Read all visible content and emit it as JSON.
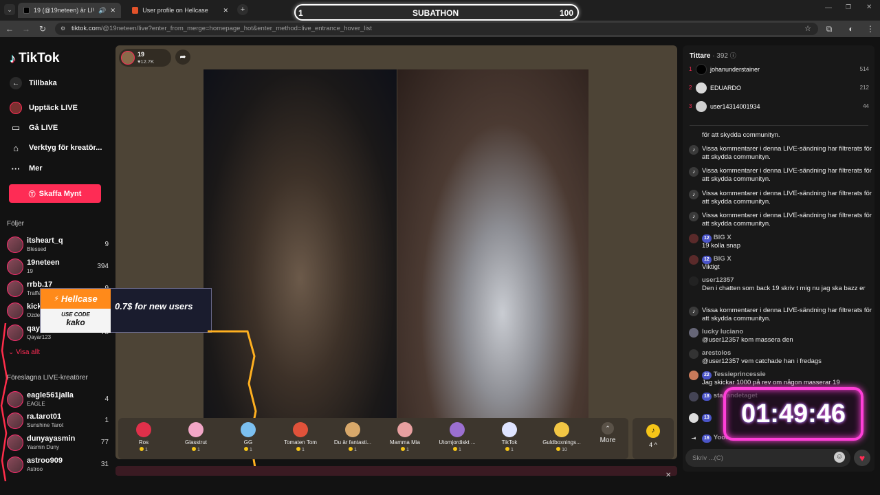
{
  "browser": {
    "tabs": [
      {
        "label": "19 (@19neteen) är LIVE – T"
      },
      {
        "label": "User profile on Hellcase"
      }
    ],
    "url_host": "tiktok.com",
    "url_path": "/@19neteen/live?enter_from_merge=homepage_hot&enter_method=live_entrance_hover_list"
  },
  "overlay": {
    "subathon_left": "1",
    "subathon_title": "SUBATHON",
    "subathon_right": "100",
    "timer": "01:49:46",
    "hellcase_brand": "Hellcase",
    "hellcase_use_code": "USE CODE",
    "hellcase_code": "kako",
    "hellcase_offer": "0.7$ for new users"
  },
  "sidebar": {
    "logo": "TikTok",
    "back": "Tillbaka",
    "nav": [
      {
        "label": "Upptäck LIVE"
      },
      {
        "label": "Gå LIVE"
      },
      {
        "label": "Verktyg för kreatör..."
      },
      {
        "label": "Mer"
      }
    ],
    "coins_button": "Skaffa Mynt",
    "following_title": "Följer",
    "following": [
      {
        "name": "itsheart_q",
        "sub": "Blessed",
        "count": "9"
      },
      {
        "name": "19neteen",
        "sub": "19",
        "count": "394"
      },
      {
        "name": "rrbb.17",
        "sub": "Traffe",
        "count": "9"
      },
      {
        "name": "kick",
        "sub": "Ozde",
        "count": ""
      },
      {
        "name": "qaya",
        "sub": "Qayar123",
        "count": "78"
      }
    ],
    "show_all": "Visa allt",
    "suggested_title": "Föreslagna LIVE-kreatörer",
    "suggested": [
      {
        "name": "eagle561jalla",
        "sub": "EAGLE",
        "count": "4"
      },
      {
        "name": "ra.tarot01",
        "sub": "Sunshine Tarot",
        "count": "1"
      },
      {
        "name": "dunyayasmin",
        "sub": "Yasmin Duny",
        "count": "77"
      },
      {
        "name": "astroo909",
        "sub": "Astroo",
        "count": "31"
      }
    ]
  },
  "host": {
    "name": "19",
    "likes": "12.7K"
  },
  "gifts": [
    {
      "name": "Ros",
      "price": "1",
      "color": "#e0304a"
    },
    {
      "name": "Glasstrut",
      "price": "1",
      "color": "#f2a6c6"
    },
    {
      "name": "GG",
      "price": "1",
      "color": "#7cc0f0"
    },
    {
      "name": "Tomaten Tom",
      "price": "1",
      "color": "#e0523a"
    },
    {
      "name": "Du är fantasti...",
      "price": "1",
      "color": "#d8a86a"
    },
    {
      "name": "Mamma Mia",
      "price": "1",
      "color": "#e8a0a0"
    },
    {
      "name": "Utomjordiskt ...",
      "price": "1",
      "color": "#9b6fd0"
    },
    {
      "name": "TikTok",
      "price": "1",
      "color": "#dfe4ff"
    },
    {
      "name": "Guldboxnings...",
      "price": "10",
      "color": "#f2c644"
    }
  ],
  "gift_more": "More",
  "gift_coins_count": "4",
  "chat": {
    "viewers_label": "Tittare",
    "viewers_count": "· 392",
    "top_viewers": [
      {
        "rank": "1",
        "name": "johanunderstainer",
        "score": "514"
      },
      {
        "rank": "2",
        "name": "EDUARDO",
        "score": "212"
      },
      {
        "rank": "3",
        "name": "user14314001934",
        "score": "44"
      }
    ],
    "messages": [
      {
        "user": "",
        "text": "för att skydda communityn."
      },
      {
        "user": "",
        "text": "Vissa kommentarer i denna LIVE-sändning har filtrerats för att skydda communityn."
      },
      {
        "user": "",
        "text": "Vissa kommentarer i denna LIVE-sändning har filtrerats för att skydda communityn."
      },
      {
        "user": "",
        "text": "Vissa kommentarer i denna LIVE-sändning har filtrerats för att skydda communityn."
      },
      {
        "user": "",
        "text": "Vissa kommentarer i denna LIVE-sändning har filtrerats för att skydda communityn."
      },
      {
        "level": "12",
        "user": "BIG X",
        "text": "19 kolla snap"
      },
      {
        "level": "12",
        "user": "BIG X",
        "text": "Viktigt"
      },
      {
        "user": "user12357",
        "text": "Den i chatten som back 19 skriv t mig nu jag ska bazz er"
      },
      {
        "user": "",
        "text": "Vissa kommentarer i denna LIVE-sändning har filtrerats för att skydda communityn."
      },
      {
        "user": "lucky luciano",
        "text": "@user12357 kom massera den"
      },
      {
        "user": "arestolos",
        "text": "@user12357 vem catchade han i fredags"
      },
      {
        "level": "22",
        "user": "Tessieprincessie",
        "text": "Jag skickar 1000 på rev om någon masserar 19"
      },
      {
        "level": "18",
        "user": "sta_andetaget",
        "text": ""
      },
      {
        "level": "13",
        "user": "",
        "text": ""
      },
      {
        "level": "16",
        "user": "Yooo",
        "text": ""
      }
    ],
    "input_placeholder": "Skriv ...(C)"
  },
  "colors": {
    "accent": "#fe2c55",
    "timer_glow": "#ff3fd8",
    "hellcase_orange": "#ff8a1a"
  }
}
